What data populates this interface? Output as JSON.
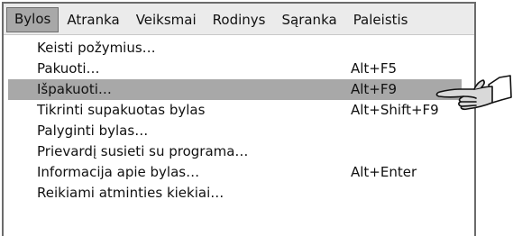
{
  "menubar": {
    "items": [
      {
        "label": "Bylos",
        "active": true
      },
      {
        "label": "Atranka"
      },
      {
        "label": "Veiksmai"
      },
      {
        "label": "Rodinys"
      },
      {
        "label": "Sąranka"
      },
      {
        "label": "Paleistis"
      }
    ]
  },
  "dropdown": {
    "items": [
      {
        "label": "Keisti požymius…",
        "shortcut": ""
      },
      {
        "label": "Pakuoti…",
        "shortcut": "Alt+F5"
      },
      {
        "label": "Išpakuoti…",
        "shortcut": "Alt+F9",
        "highlighted": true
      },
      {
        "label": "Tikrinti supakuotas bylas",
        "shortcut": "Alt+Shift+F9"
      },
      {
        "label": "Palyginti bylas…",
        "shortcut": ""
      },
      {
        "label": "Prievardį susieti su programa…",
        "shortcut": ""
      },
      {
        "label": "Informacija apie bylas…",
        "shortcut": "Alt+Enter"
      },
      {
        "label": "Reikiami atminties kiekiai…",
        "shortcut": ""
      }
    ]
  },
  "colors": {
    "highlight": "#a8a8a8",
    "menubar": "#ebebeb",
    "border": "#6b6b6b"
  },
  "icons": {
    "pointer": "pointing-hand-icon"
  }
}
